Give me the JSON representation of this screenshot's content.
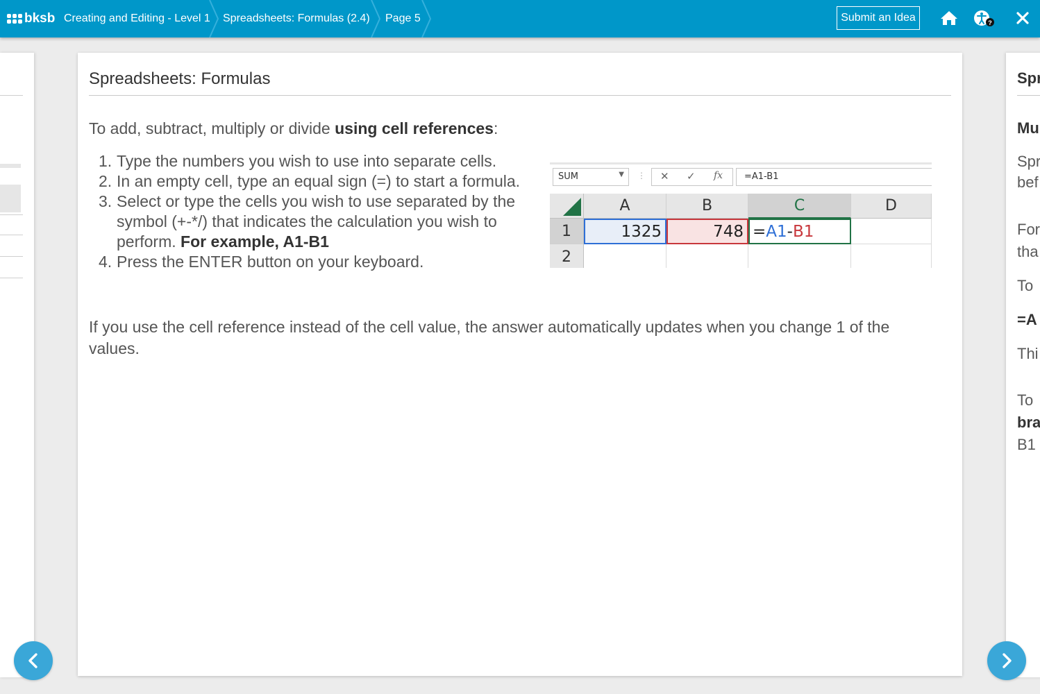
{
  "header": {
    "logo_text": "bksb",
    "breadcrumbs": [
      "Creating and Editing - Level 1",
      "Spreadsheets: Formulas (2.4)",
      "Page 5"
    ],
    "submit_label": "Submit an Idea",
    "icons": [
      "home-icon",
      "accessibility-icon",
      "help-icon",
      "close-icon"
    ],
    "accent_color": "#0097c9"
  },
  "card": {
    "title": "Spreadsheets: Formulas",
    "intro_prefix": "To add, subtract, multiply or divide ",
    "intro_bold": "using cell references",
    "intro_suffix": ":",
    "steps": [
      {
        "num": "1.",
        "text": "Type the numbers you wish to use into separate cells."
      },
      {
        "num": "2.",
        "text": "In an empty cell, type an equal sign (=) to start a formula."
      },
      {
        "num": "3.",
        "text": "Select or type the cells you wish to use separated by the symbol (+-*/) that indicates the calculation you wish to perform. ",
        "bold": "For example, A1-B1"
      },
      {
        "num": "4.",
        "text": "Press the ENTER button on your keyboard."
      }
    ],
    "paragraph": "If you use the cell reference instead of the cell value, the answer automatically updates when you change 1 of the values."
  },
  "spreadsheet": {
    "name_box": "SUM",
    "formula_bar": "=A1-B1",
    "formula_buttons": [
      "cancel-icon",
      "enter-icon",
      "fx-icon"
    ],
    "columns": [
      "A",
      "B",
      "C",
      "D"
    ],
    "rows": [
      "1",
      "2"
    ],
    "a1": "1325",
    "b1": "748",
    "c1_parts": [
      "=",
      "A1",
      "-",
      "B1"
    ],
    "ref_colors": {
      "a1": "#2e6fd6",
      "b1": "#c8373c",
      "active": "#217346"
    }
  },
  "right_panel": {
    "lines": [
      "Spr",
      "Mu",
      "Spr",
      "bef",
      "For",
      "tha",
      "To",
      "=A",
      "Thi",
      "To",
      "bra",
      "B1"
    ]
  },
  "nav": {
    "prev_icon": "chevron-left-icon",
    "next_icon": "chevron-right-icon"
  }
}
